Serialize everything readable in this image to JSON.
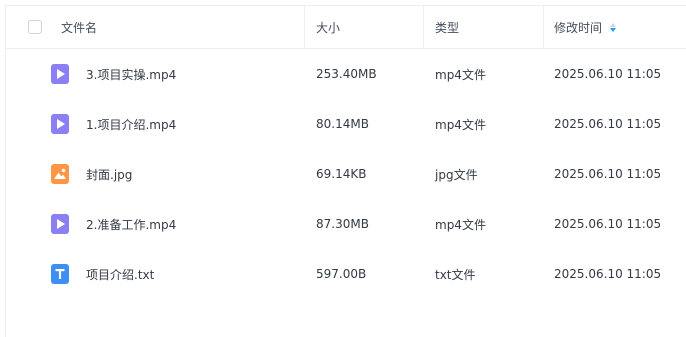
{
  "header": {
    "name": "文件名",
    "size": "大小",
    "type": "类型",
    "modified": "修改时间"
  },
  "colors": {
    "video": "#8b80f3",
    "image": "#ff9645",
    "text": "#3e8ff3",
    "sort_active": "#1aa0f0"
  },
  "files": [
    {
      "name": "3.项目实操.mp4",
      "size": "253.40MB",
      "type": "mp4文件",
      "modified": "2025.06.10 11:05",
      "icon": "video-file-icon"
    },
    {
      "name": "1.项目介绍.mp4",
      "size": "80.14MB",
      "type": "mp4文件",
      "modified": "2025.06.10 11:05",
      "icon": "video-file-icon"
    },
    {
      "name": "封面.jpg",
      "size": "69.14KB",
      "type": "jpg文件",
      "modified": "2025.06.10 11:05",
      "icon": "image-file-icon"
    },
    {
      "name": "2.准备工作.mp4",
      "size": "87.30MB",
      "type": "mp4文件",
      "modified": "2025.06.10 11:05",
      "icon": "video-file-icon"
    },
    {
      "name": "项目介绍.txt",
      "size": "597.00B",
      "type": "txt文件",
      "modified": "2025.06.10 11:05",
      "icon": "text-file-icon"
    }
  ]
}
